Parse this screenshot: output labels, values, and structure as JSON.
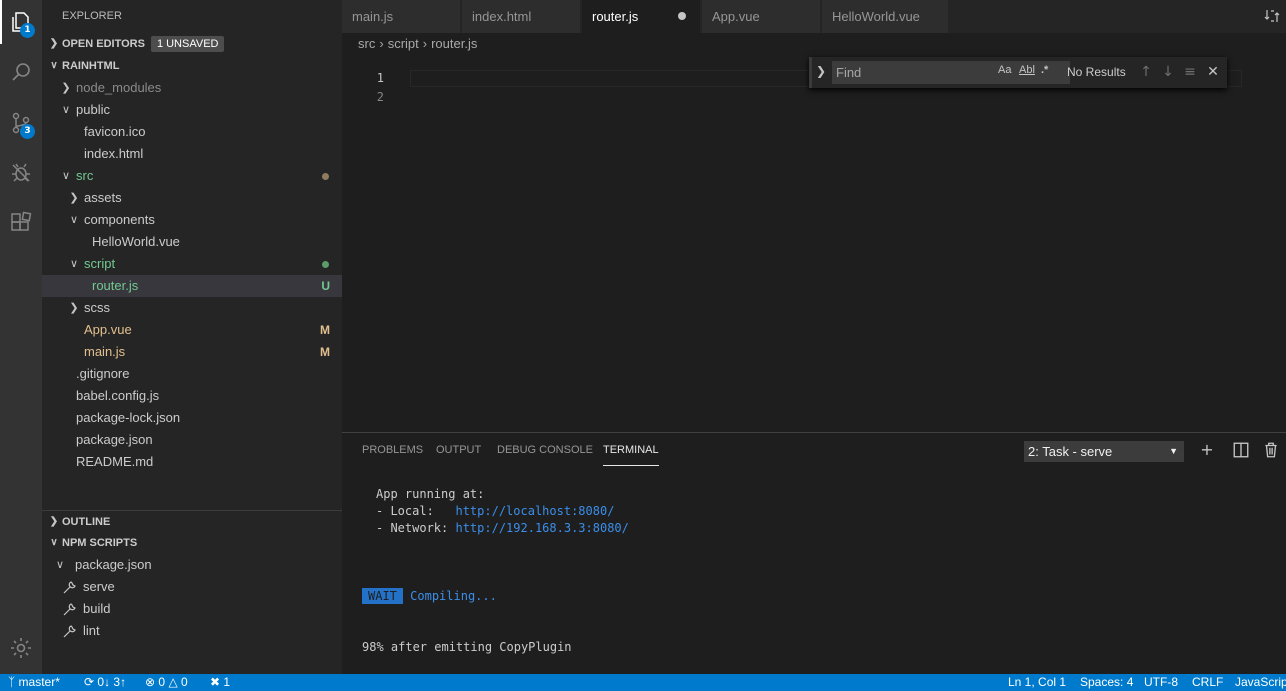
{
  "activity": {
    "explorer_badge": "1",
    "scm_badge": "3"
  },
  "sidebar": {
    "title": "EXPLORER",
    "open_editors_label": "OPEN EDITORS",
    "unsaved_badge": "1 UNSAVED",
    "project_label": "RAINHTML",
    "tree": [
      {
        "label": "node_modules",
        "status": ""
      },
      {
        "label": "public",
        "status": ""
      },
      {
        "label": "favicon.ico",
        "status": ""
      },
      {
        "label": "index.html",
        "status": ""
      },
      {
        "label": "src",
        "status": ""
      },
      {
        "label": "assets",
        "status": ""
      },
      {
        "label": "components",
        "status": ""
      },
      {
        "label": "HelloWorld.vue",
        "status": ""
      },
      {
        "label": "script",
        "status": ""
      },
      {
        "label": "router.js",
        "status": "U"
      },
      {
        "label": "scss",
        "status": ""
      },
      {
        "label": "App.vue",
        "status": "M"
      },
      {
        "label": "main.js",
        "status": "M"
      },
      {
        "label": ".gitignore",
        "status": ""
      },
      {
        "label": "babel.config.js",
        "status": ""
      },
      {
        "label": "package-lock.json",
        "status": ""
      },
      {
        "label": "package.json",
        "status": ""
      },
      {
        "label": "README.md",
        "status": ""
      }
    ],
    "outline_label": "OUTLINE",
    "npm_label": "NPM SCRIPTS",
    "npm_file": "package.json",
    "npm_scripts": [
      "serve",
      "build",
      "lint"
    ]
  },
  "tabs": [
    "main.js",
    "index.html",
    "router.js",
    "App.vue",
    "HelloWorld.vue"
  ],
  "breadcrumb": [
    "src",
    "script",
    "router.js"
  ],
  "editor": {
    "line_numbers": [
      "1",
      "2"
    ]
  },
  "find": {
    "placeholder": "Find",
    "match_case": "Aa",
    "whole_word": "Abl",
    "regex": ".*",
    "results": "No Results"
  },
  "panel": {
    "tabs": [
      "PROBLEMS",
      "OUTPUT",
      "DEBUG CONSOLE",
      "TERMINAL"
    ],
    "terminal_select": "2: Task - serve",
    "terminal": {
      "running": "App running at:",
      "local_label": "- Local:   ",
      "local_url": "http://localhost:8080/",
      "network_label": "- Network: ",
      "network_url": "http://192.168.3.3:8080/",
      "wait_badge": "WAIT",
      "compiling": "Compiling...",
      "progress": "98% after emitting CopyPlugin"
    }
  },
  "status": {
    "branch": "master*",
    "sync": "0↓ 3↑",
    "errors": "0",
    "warnings": "0",
    "tools": "1",
    "position": "Ln 1, Col 1",
    "spaces": "Spaces: 4",
    "encoding": "UTF-8",
    "eol": "CRLF",
    "language": "JavaScript"
  },
  "colors": {
    "accent": "#007acc",
    "untracked": "#73c991",
    "modified": "#e2c08d"
  }
}
